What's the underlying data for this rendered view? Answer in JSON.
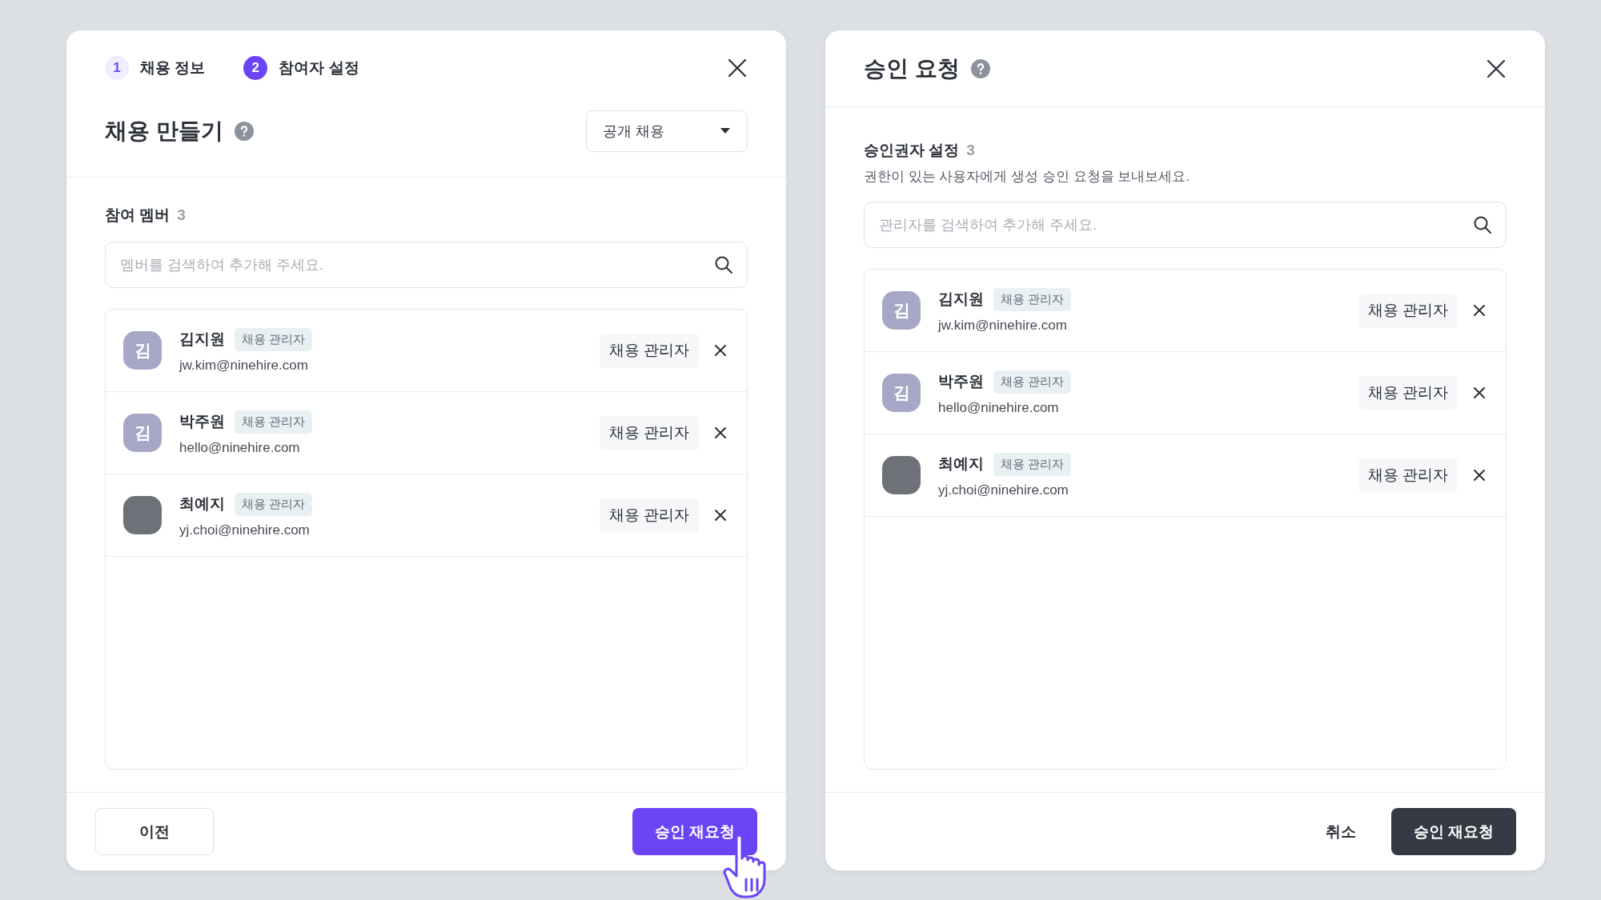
{
  "left_dialog": {
    "steps": [
      {
        "number": "1",
        "label": "채용 정보",
        "selected": false
      },
      {
        "number": "2",
        "label": "참여자 설정",
        "selected": true
      }
    ],
    "title": "채용 만들기",
    "type_select": {
      "value": "공개 채용"
    },
    "section": {
      "label": "참여 멤버",
      "count": "3"
    },
    "search": {
      "placeholder": "멤버를 검색하여 추가해 주세요."
    },
    "members": [
      {
        "avatar": {
          "kind": "initial",
          "text": "김"
        },
        "name": "김지원",
        "tag": "채용 관리자",
        "email": "jw.kim@ninehire.com",
        "role": "채용 관리자"
      },
      {
        "avatar": {
          "kind": "initial",
          "text": "김"
        },
        "name": "박주원",
        "tag": "채용 관리자",
        "email": "hello@ninehire.com",
        "role": "채용 관리자"
      },
      {
        "avatar": {
          "kind": "photo"
        },
        "name": "최예지",
        "tag": "채용 관리자",
        "email": "yj.choi@ninehire.com",
        "role": "채용 관리자"
      }
    ],
    "footer": {
      "back_button": "이전",
      "submit_button": "승인 재요청"
    }
  },
  "right_dialog": {
    "title": "승인 요청",
    "section": {
      "label": "승인권자 설정",
      "count": "3",
      "description": "권한이 있는 사용자에게 생성 승인 요청을 보내보세요."
    },
    "search": {
      "placeholder": "관리자를 검색하여 추가해 주세요."
    },
    "members": [
      {
        "avatar": {
          "kind": "initial",
          "text": "김"
        },
        "name": "김지원",
        "tag": "채용 관리자",
        "email": "jw.kim@ninehire.com",
        "role": "채용 관리자"
      },
      {
        "avatar": {
          "kind": "initial",
          "text": "김"
        },
        "name": "박주원",
        "tag": "채용 관리자",
        "email": "hello@ninehire.com",
        "role": "채용 관리자"
      },
      {
        "avatar": {
          "kind": "photo"
        },
        "name": "최예지",
        "tag": "채용 관리자",
        "email": "yj.choi@ninehire.com",
        "role": "채용 관리자"
      }
    ],
    "footer": {
      "cancel_button": "취소",
      "submit_button": "승인 재요청"
    }
  }
}
